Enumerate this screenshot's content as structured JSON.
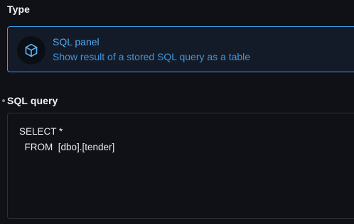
{
  "type_section": {
    "label": "Type",
    "card": {
      "icon": "cube-icon",
      "title": "SQL panel",
      "description": "Show result of a stored SQL query as a table"
    }
  },
  "sql_section": {
    "label": "SQL query",
    "query_lines": [
      "SELECT *",
      "  FROM  [dbo].[tender]"
    ]
  },
  "colors": {
    "accent": "#3aa0e8",
    "background": "#0f1117"
  }
}
